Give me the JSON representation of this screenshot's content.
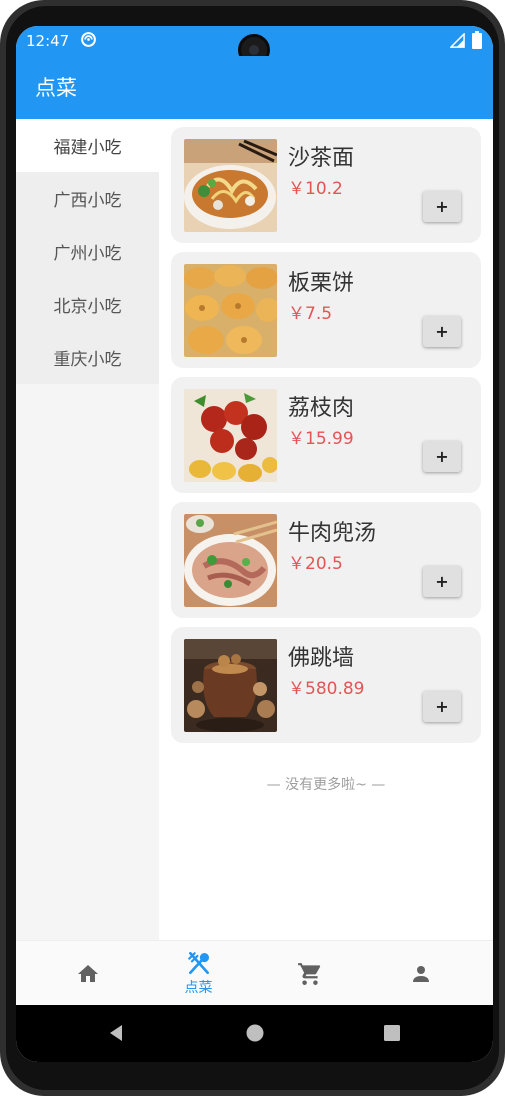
{
  "status_bar": {
    "time": "12:47",
    "icons": [
      "sync-icon",
      "signal-icon",
      "battery-icon"
    ]
  },
  "app_bar": {
    "title": "点菜",
    "color": "#2196f3"
  },
  "sidebar": {
    "items": [
      {
        "label": "福建小吃",
        "active": true
      },
      {
        "label": "广西小吃",
        "active": false
      },
      {
        "label": "广州小吃",
        "active": false
      },
      {
        "label": "北京小吃",
        "active": false
      },
      {
        "label": "重庆小吃",
        "active": false
      }
    ]
  },
  "foods": [
    {
      "name": "沙茶面",
      "price": "￥10.2",
      "add_label": "+",
      "image": "noodle-bowl-image"
    },
    {
      "name": "板栗饼",
      "price": "￥7.5",
      "add_label": "+",
      "image": "chestnut-pastry-image"
    },
    {
      "name": "荔枝肉",
      "price": "￥15.99",
      "add_label": "+",
      "image": "sweet-sour-pork-image"
    },
    {
      "name": "牛肉兜汤",
      "price": "￥20.5",
      "add_label": "+",
      "image": "beef-soup-image"
    },
    {
      "name": "佛跳墙",
      "price": "￥580.89",
      "add_label": "+",
      "image": "buddha-jumps-wall-image"
    }
  ],
  "list_footer": "— 没有更多啦~ —",
  "bottom_nav": {
    "items": [
      {
        "icon": "home-icon",
        "label": "",
        "active": false
      },
      {
        "icon": "utensils-icon",
        "label": "点菜",
        "active": true
      },
      {
        "icon": "cart-icon",
        "label": "",
        "active": false
      },
      {
        "icon": "person-icon",
        "label": "",
        "active": false
      }
    ],
    "active_color": "#2196f3",
    "inactive_color": "#616161"
  },
  "colors": {
    "accent": "#2196f3",
    "price": "#e25555",
    "card_bg": "#f1f1f1"
  }
}
